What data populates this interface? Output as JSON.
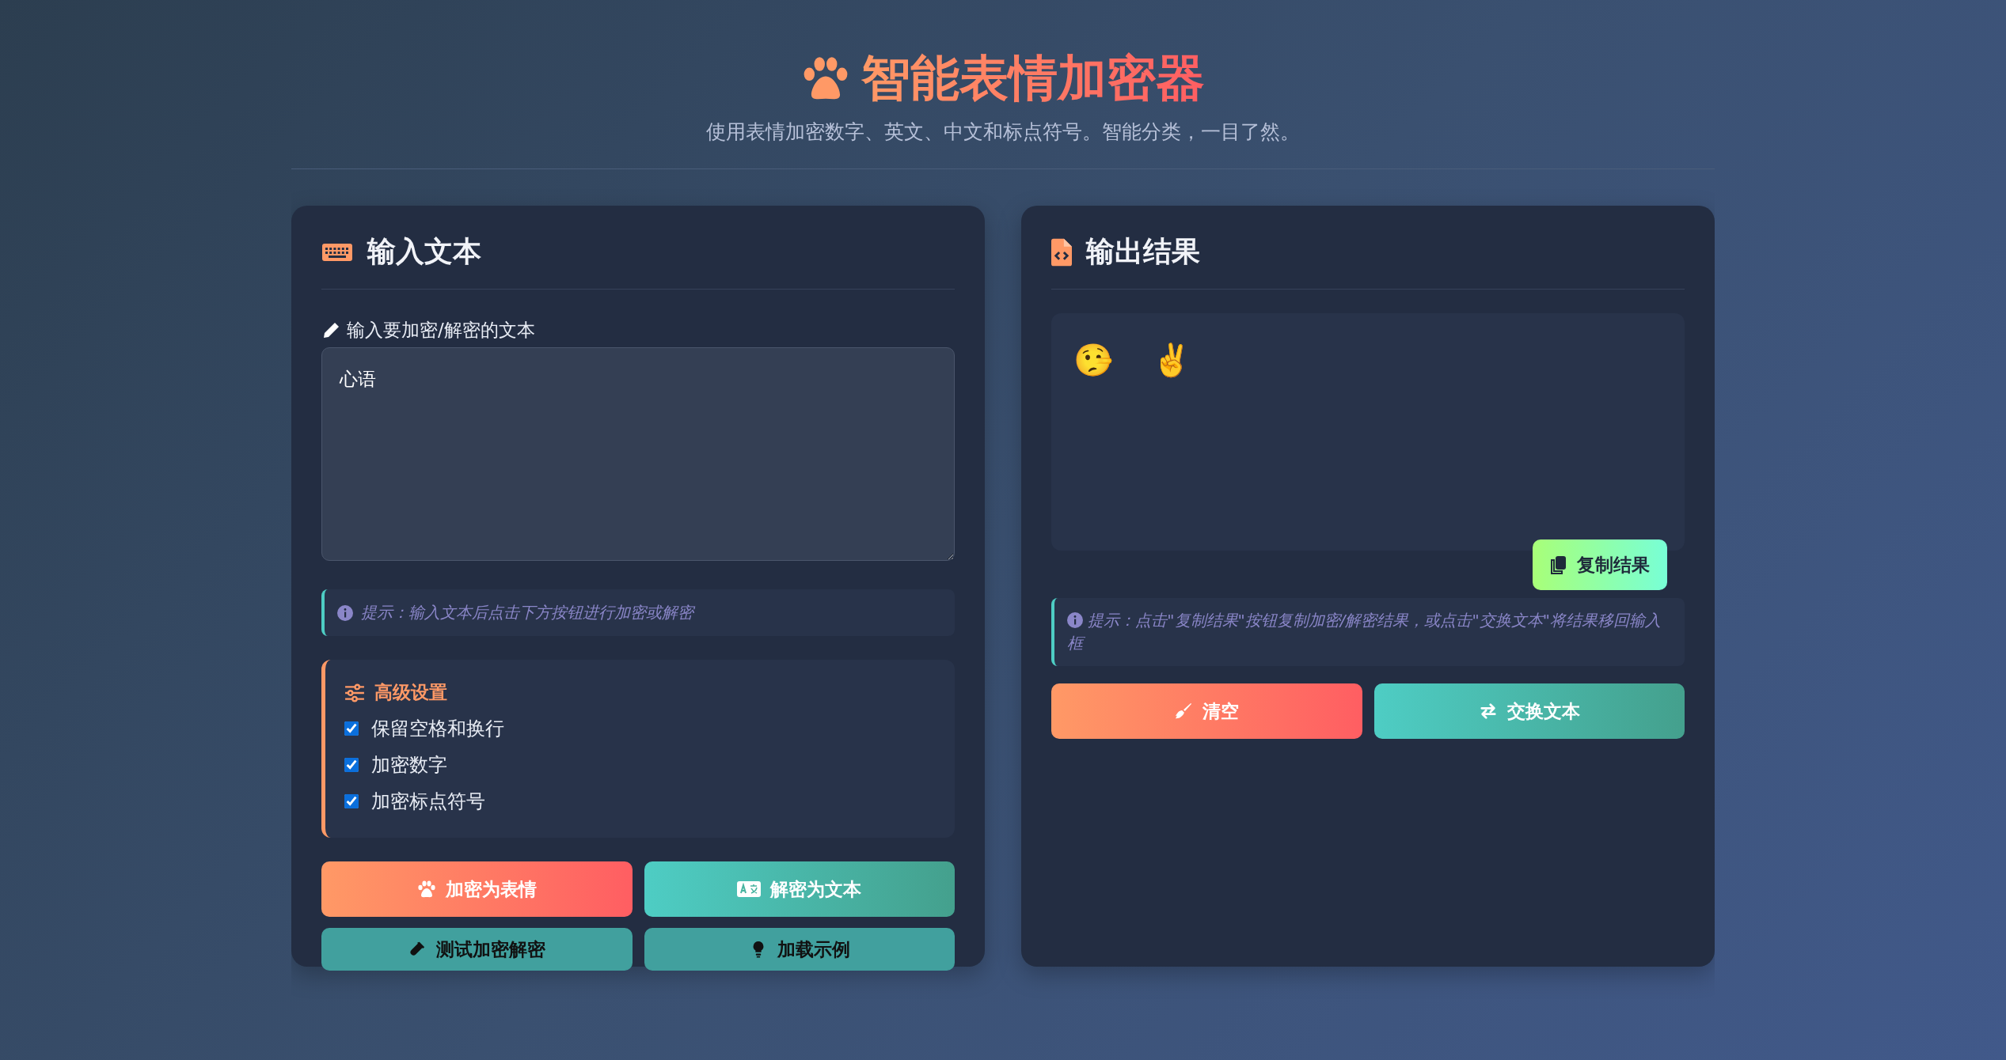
{
  "header": {
    "title": "智能表情加密器",
    "subtitle": "使用表情加密数字、英文、中文和标点符号。智能分类，一目了然。"
  },
  "input_panel": {
    "title": "输入文本",
    "field_label": "输入要加密/解密的文本",
    "value": "心语",
    "hint": "提示：输入文本后点击下方按钮进行加密或解密",
    "settings": {
      "title": "高级设置",
      "options": [
        {
          "label": "保留空格和换行",
          "checked": true
        },
        {
          "label": "加密数字",
          "checked": true
        },
        {
          "label": "加密标点符号",
          "checked": true
        }
      ]
    },
    "buttons": [
      {
        "label": "加密为表情",
        "kind": "encrypt"
      },
      {
        "label": "解密为文本",
        "kind": "decrypt"
      },
      {
        "label": "测试加密解密",
        "kind": "test"
      },
      {
        "label": "加载示例",
        "kind": "example"
      }
    ]
  },
  "output_panel": {
    "title": "输出结果",
    "output": "🤥 ✌️",
    "copy_button": "复制结果",
    "hint": "提示：点击\"复制结果\"按钮复制加密/解密结果，或点击\"交换文本\"将结果移回输入框",
    "buttons": [
      {
        "label": "清空",
        "kind": "clear"
      },
      {
        "label": "交换文本",
        "kind": "swap"
      }
    ]
  }
}
